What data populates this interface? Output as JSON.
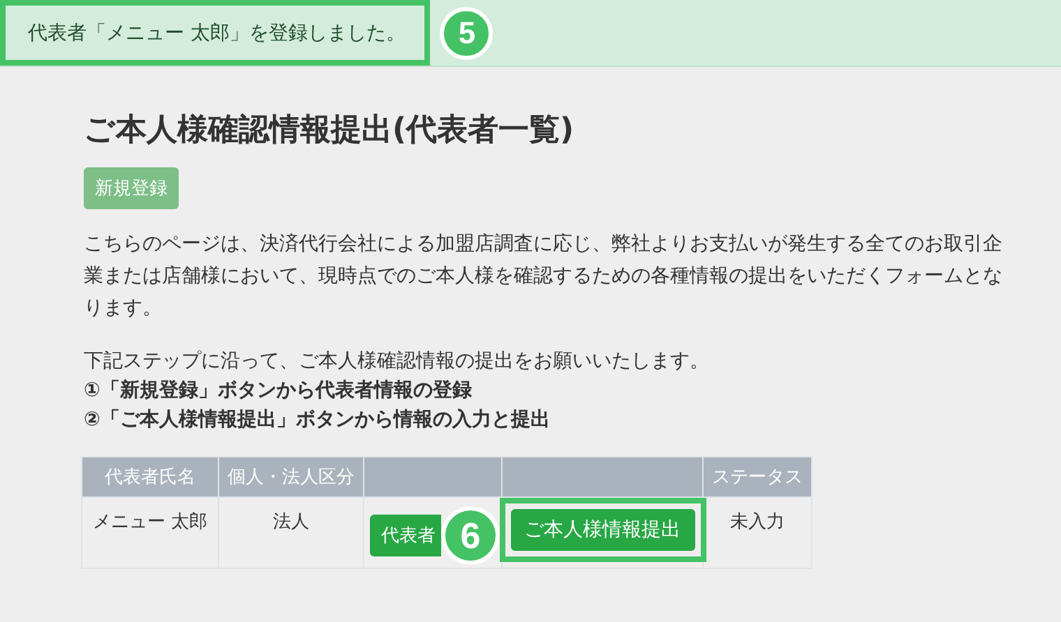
{
  "notice": {
    "text": "代表者「メニュー 太郎」を登録しました。",
    "highlighted": true,
    "badge": "5"
  },
  "title": "ご本人様確認情報提出(代表者一覧)",
  "new_button": "新規登録",
  "description": "こちらのページは、決済代行会社による加盟店調査に応じ、弊社よりお支払いが発生する全てのお取引企業または店舗様において、現時点でのご本人様を確認するための各種情報の提出をいただくフォームとなります。",
  "instruction": "下記ステップに沿って、ご本人様確認情報の提出をお願いいたします。",
  "steps": [
    "①「新規登録」ボタンから代表者情報の登録",
    "②「ご本人様情報提出」ボタンから情報の入力と提出"
  ],
  "table": {
    "columns": [
      {
        "label": "代表者氏名"
      },
      {
        "label": "個人・法人区分"
      },
      {},
      {},
      {
        "label": "ステータス"
      }
    ],
    "rows": [
      {
        "name": "メニュー 太郎",
        "type": "法人",
        "edit_button": "代表者",
        "submit_button": "ご本人様情報提出",
        "submit_highlighted": true,
        "badge": "6",
        "status": "未入力"
      }
    ]
  }
}
